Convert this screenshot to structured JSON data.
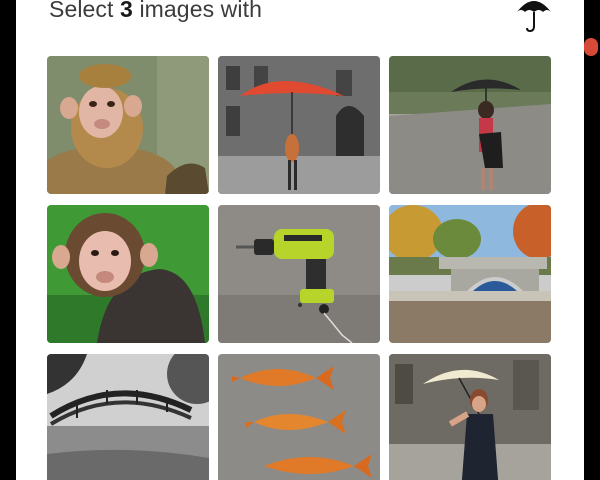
{
  "challenge": {
    "prompt_before": "Select",
    "prompt_count": "3",
    "prompt_after": "images with",
    "reference_icon": "umbrella-icon",
    "accent_color": "#d84a38"
  },
  "tiles": [
    {
      "subject": "monkey"
    },
    {
      "subject": "girl with red umbrella"
    },
    {
      "subject": "woman with black umbrella"
    },
    {
      "subject": "monkey"
    },
    {
      "subject": "cordless drill"
    },
    {
      "subject": "bridge over river"
    },
    {
      "subject": "arched footbridge"
    },
    {
      "subject": "goldfish"
    },
    {
      "subject": "woman with white umbrella"
    }
  ]
}
